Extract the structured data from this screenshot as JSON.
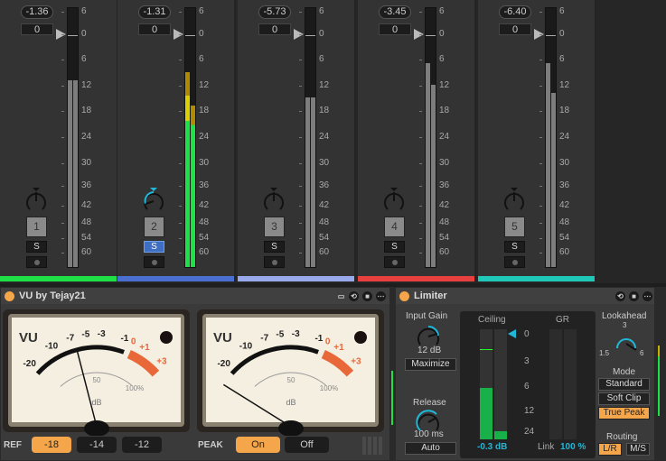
{
  "mixer": {
    "scale": [
      "6",
      "0",
      "6",
      "12",
      "18",
      "24",
      "30",
      "36",
      "42",
      "48",
      "54",
      "60"
    ],
    "tracks": [
      {
        "volume": "-1.36",
        "pan": "0",
        "number": "1",
        "solo": "S",
        "solo_active": false,
        "color": "#1fe046",
        "meter_db": [
          -11,
          -11
        ],
        "meter_type": "gray",
        "pan_active": false
      },
      {
        "volume": "-1.31",
        "pan": "0",
        "number": "2",
        "solo": "S",
        "solo_active": true,
        "color": "#4a6fd0",
        "meter_db": [
          -9,
          -17
        ],
        "meter_type": "color",
        "pan_active": true
      },
      {
        "volume": "-5.73",
        "pan": "0",
        "number": "3",
        "solo": "S",
        "solo_active": false,
        "color": "#9aa8ec",
        "meter_db": [
          -15,
          -15
        ],
        "meter_type": "gray",
        "pan_active": false
      },
      {
        "volume": "-3.45",
        "pan": "0",
        "number": "4",
        "solo": "S",
        "solo_active": false,
        "color": "#e8403e",
        "meter_db": [
          -7,
          -12
        ],
        "meter_type": "gray",
        "pan_active": false
      },
      {
        "volume": "-6.40",
        "pan": "0",
        "number": "5",
        "solo": "S",
        "solo_active": false,
        "color": "#1fc8b8",
        "meter_db": [
          -7,
          -14
        ],
        "meter_type": "gray",
        "pan_active": false
      }
    ]
  },
  "vu": {
    "title": "VU by Tejay21",
    "meter_label": "VU",
    "scale_db": [
      "-20",
      "-10",
      "-7",
      "-5",
      "-3",
      "-1",
      "0",
      "+1",
      "+3"
    ],
    "scale_pct": [
      "50",
      "100%"
    ],
    "unit": "dB",
    "needles": [
      -6,
      -21
    ],
    "ref_label": "REF",
    "ref_options": [
      "-18",
      "-14",
      "-12"
    ],
    "ref_selected": "-18",
    "peak_label": "PEAK",
    "peak_options": [
      "On",
      "Off"
    ],
    "peak_selected": "On"
  },
  "limiter": {
    "title": "Limiter",
    "input_gain_label": "Input Gain",
    "input_gain": "12 dB",
    "maximize": "Maximize",
    "release_label": "Release",
    "release": "100 ms",
    "auto": "Auto",
    "ceiling_label": "Ceiling",
    "gr_label": "GR",
    "scale": [
      "0",
      "3",
      "6",
      "12",
      "24"
    ],
    "ceiling_value": "-0.3 dB",
    "link_label": "Link",
    "link_value": "100 %",
    "lookahead_label": "Lookahead",
    "lookahead_ticks": [
      "1.5",
      "3",
      "6"
    ],
    "mode_label": "Mode",
    "modes": [
      "Standard",
      "Soft Clip",
      "True Peak"
    ],
    "mode_selected": "True Peak",
    "routing_label": "Routing",
    "routing": [
      "L/R",
      "M/S"
    ],
    "routing_selected": "L/R"
  }
}
